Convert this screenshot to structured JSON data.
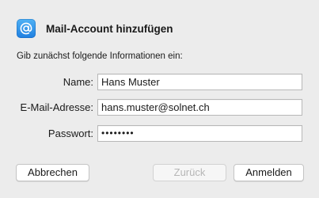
{
  "dialog": {
    "title": "Mail-Account hinzufügen",
    "icon": "at-sign-icon",
    "instruction": "Gib zunächst folgende Informationen ein:"
  },
  "form": {
    "name": {
      "label": "Name:",
      "value": "Hans Muster"
    },
    "email": {
      "label": "E-Mail-Adresse:",
      "value": "hans.muster@solnet.ch"
    },
    "password": {
      "label": "Passwort:",
      "value": "••••••••"
    }
  },
  "buttons": {
    "cancel": "Abbrechen",
    "back": "Zurück",
    "signin": "Anmelden"
  },
  "colors": {
    "background": "#ececec",
    "accent": "#1f7fe0",
    "disabled_text": "#b6b6b6"
  }
}
